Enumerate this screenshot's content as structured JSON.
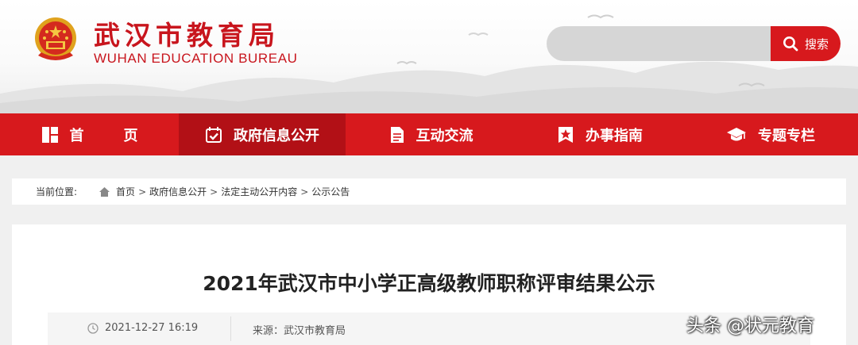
{
  "header": {
    "title": "武汉市教育局",
    "subtitle": "WUHAN EDUCATION BUREAU",
    "emblem_icon": "national-emblem-icon"
  },
  "search": {
    "placeholder": "",
    "value": "",
    "button_label": "搜索",
    "button_icon": "search-icon"
  },
  "nav": {
    "items": [
      {
        "label": "首页",
        "icon": "home-grid-icon",
        "active": false
      },
      {
        "label": "政府信息公开",
        "icon": "calendar-check-icon",
        "active": true
      },
      {
        "label": "互动交流",
        "icon": "document-icon",
        "active": false
      },
      {
        "label": "办事指南",
        "icon": "star-badge-icon",
        "active": false
      },
      {
        "label": "专题专栏",
        "icon": "graduation-cap-icon",
        "active": false
      }
    ]
  },
  "breadcrumb": {
    "prefix": "当前位置:",
    "separator": ">",
    "items": [
      "首页",
      "政府信息公开",
      "法定主动公开内容",
      "公示公告"
    ]
  },
  "article": {
    "title": "2021年武汉市中小学正高级教师职称评审结果公示",
    "date": "2021-12-27 16:19",
    "source": "来源：武汉市教育局"
  },
  "watermark": "头条 @状元教育",
  "colors": {
    "brand_red": "#d7191d",
    "active_red": "#b21016",
    "title_red": "#c8151d"
  }
}
